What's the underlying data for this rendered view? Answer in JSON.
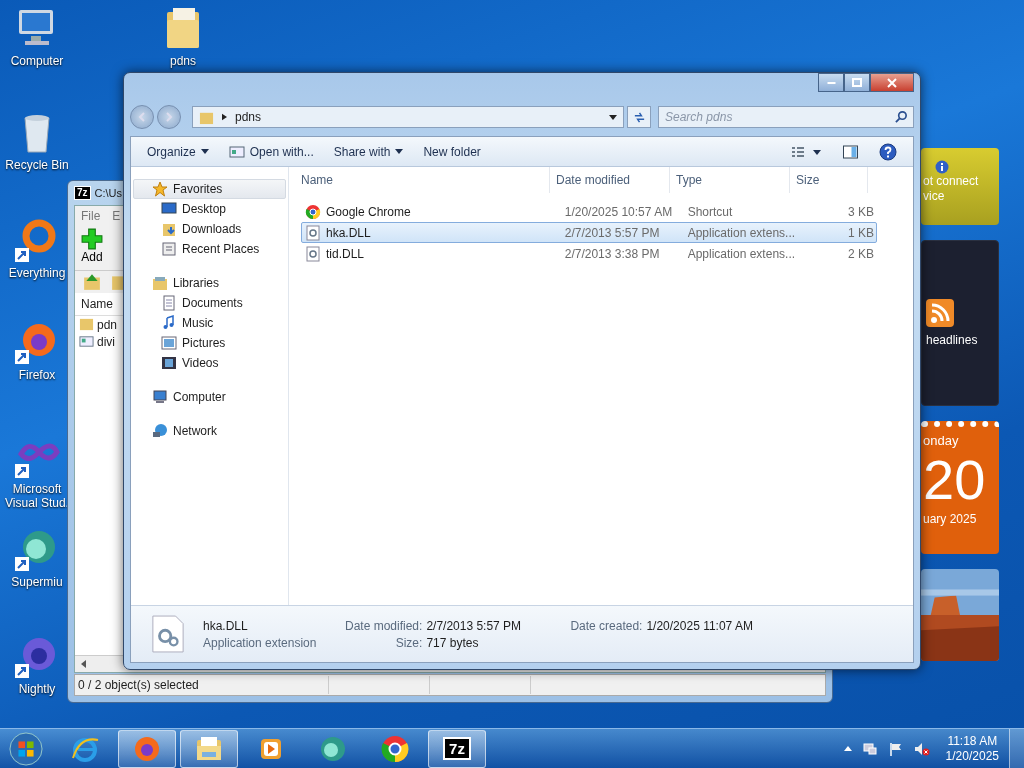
{
  "desktop_icons": [
    {
      "label": "Computer",
      "kind": "computer",
      "shortcut": false
    },
    {
      "label": "pdns",
      "kind": "folder",
      "shortcut": false
    },
    {
      "label": "Recycle Bin",
      "kind": "recycle",
      "shortcut": false
    },
    {
      "label": "Everything",
      "kind": "everything",
      "shortcut": true
    },
    {
      "label": "Firefox",
      "kind": "firefox",
      "shortcut": true
    },
    {
      "label": "Microsoft Visual Stud.",
      "kind": "vs",
      "shortcut": true
    },
    {
      "label": "Supermiu",
      "kind": "supermium",
      "shortcut": true
    },
    {
      "label": "Nightly",
      "kind": "nightly",
      "shortcut": true
    }
  ],
  "archive_window": {
    "logo": "7z",
    "title": "C:\\Us",
    "menu": [
      "File",
      "E"
    ],
    "toolbar": [
      "Add"
    ],
    "column": "Name",
    "rows": [
      {
        "name": "pdn",
        "kind": "folder"
      },
      {
        "name": "divi",
        "kind": "file"
      }
    ],
    "status": "0 / 2 object(s) selected"
  },
  "explorer": {
    "address": "pdns",
    "search": {
      "placeholder": "Search pdns"
    },
    "toolbar": [
      {
        "label": "Organize",
        "dropdown": true,
        "kind": "plain"
      },
      {
        "label": "Open with...",
        "dropdown": false,
        "kind": "openwith"
      },
      {
        "label": "Share with",
        "dropdown": true,
        "kind": "plain"
      },
      {
        "label": "New folder",
        "dropdown": false,
        "kind": "plain"
      }
    ],
    "nav": [
      {
        "label": "Favorites",
        "kind": "favorites",
        "selected": true,
        "children": [
          {
            "label": "Desktop",
            "kind": "desktop"
          },
          {
            "label": "Downloads",
            "kind": "downloads"
          },
          {
            "label": "Recent Places",
            "kind": "recent"
          }
        ]
      },
      {
        "label": "Libraries",
        "kind": "libraries",
        "selected": false,
        "children": [
          {
            "label": "Documents",
            "kind": "documents"
          },
          {
            "label": "Music",
            "kind": "music"
          },
          {
            "label": "Pictures",
            "kind": "pictures"
          },
          {
            "label": "Videos",
            "kind": "videos"
          }
        ]
      },
      {
        "label": "Computer",
        "kind": "computer",
        "selected": false
      },
      {
        "label": "Network",
        "kind": "network",
        "selected": false
      }
    ],
    "columns": [
      "Name",
      "Date modified",
      "Type",
      "Size"
    ],
    "files": [
      {
        "name": "Google Chrome",
        "modified": "1/20/2025 10:57 AM",
        "type": "Shortcut",
        "size": "3 KB",
        "kind": "chrome",
        "selected": false
      },
      {
        "name": "hka.DLL",
        "modified": "2/7/2013 5:57 PM",
        "type": "Application extens...",
        "size": "1 KB",
        "kind": "dll",
        "selected": true
      },
      {
        "name": "tid.DLL",
        "modified": "2/7/2013 3:38 PM",
        "type": "Application extens...",
        "size": "2 KB",
        "kind": "dll",
        "selected": false
      }
    ],
    "details": {
      "name": "hka.DLL",
      "type": "Application extension",
      "fields": [
        {
          "label": "Date modified:",
          "value": "2/7/2013 5:57 PM"
        },
        {
          "label": "Date created:",
          "value": "1/20/2025 11:07 AM"
        },
        {
          "label": "Size:",
          "value": "717 bytes"
        }
      ]
    }
  },
  "gadgets": [
    {
      "kind": "weather",
      "lines": [
        "ot connect",
        "vice"
      ]
    },
    {
      "kind": "feed",
      "lines": [
        "headlines"
      ]
    },
    {
      "kind": "calendar",
      "lines": [
        "onday",
        "20",
        "uary 2025"
      ]
    },
    {
      "kind": "slideshow"
    }
  ],
  "taskbar": {
    "apps": [
      {
        "kind": "ie",
        "active": false
      },
      {
        "kind": "firefox",
        "active": true
      },
      {
        "kind": "explorer",
        "active": true
      },
      {
        "kind": "media",
        "active": false
      },
      {
        "kind": "supermium",
        "active": false
      },
      {
        "kind": "chrome",
        "active": false
      },
      {
        "kind": "sevenzip",
        "active": true,
        "text": "7z"
      }
    ],
    "time": "11:18 AM",
    "date": "1/20/2025"
  }
}
